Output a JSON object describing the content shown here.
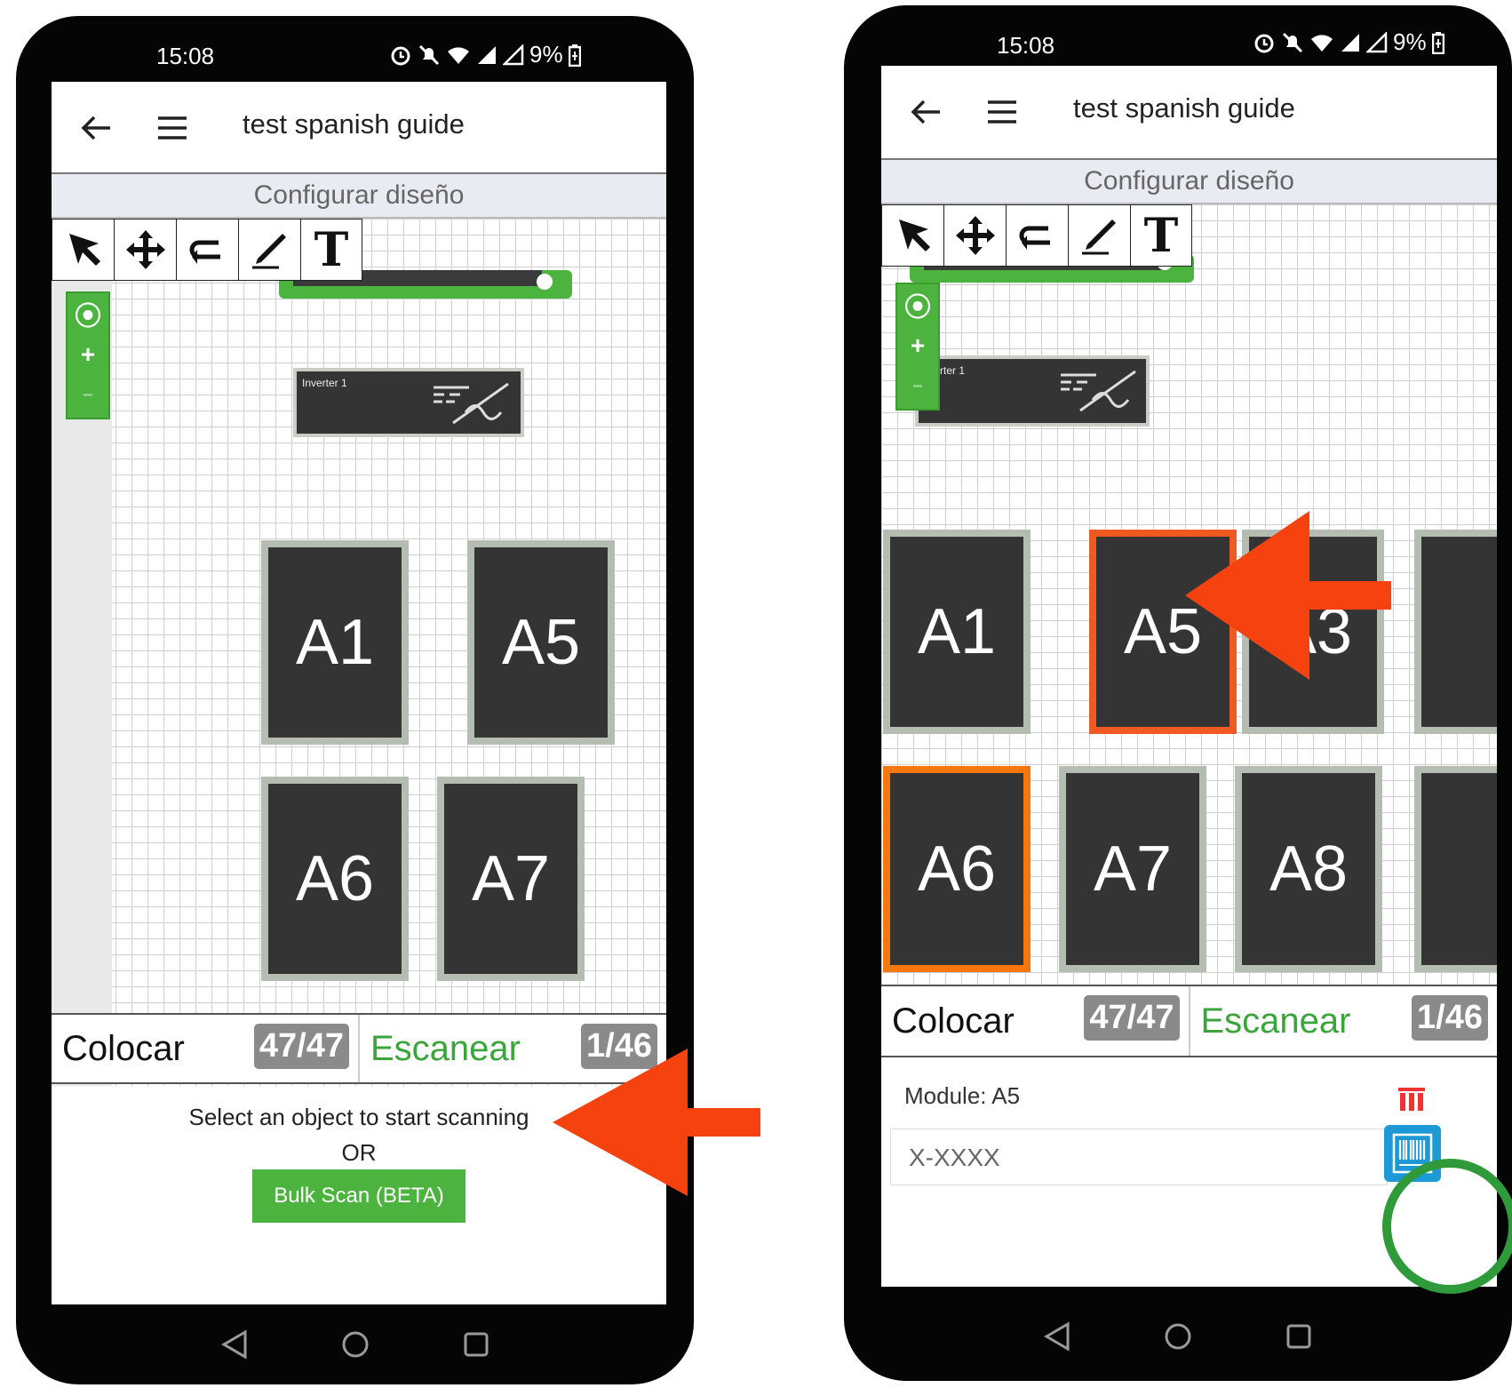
{
  "colors": {
    "accent_green": "#4cb43e",
    "text_green": "#3aa53a",
    "arrow_red": "#f5420f",
    "select_red": "#f05a22",
    "select_orange": "#f7770f",
    "ring_green": "#2f9a3a",
    "barcode_blue": "#1d9ad6"
  },
  "status": {
    "time": "15:08",
    "battery": "9%"
  },
  "app": {
    "title": "test spanish guide",
    "subtitle": "Configurar diseño"
  },
  "toolbar": {
    "tools": [
      "pointer-icon",
      "move-icon",
      "undo-icon",
      "pencil-icon",
      "text-tool-icon"
    ],
    "text_tool_label": "T"
  },
  "zoom": {
    "locate": "⦿",
    "plus": "+",
    "minus": "−"
  },
  "phone1": {
    "inverter_label": "Inverter 1",
    "modules": [
      "A1",
      "A5",
      "A6",
      "A7"
    ],
    "tabs": {
      "place_label": "Colocar",
      "place_count": "47/47",
      "scan_label": "Escanear",
      "scan_count": "1/46"
    },
    "hint": "Select an object to start scanning",
    "or": "OR",
    "bulk_button": "Bulk Scan (BETA)"
  },
  "phone2": {
    "inverter_label": "rter 1",
    "modules": [
      "A1",
      "A5",
      "A3",
      "A6",
      "A7",
      "A8"
    ],
    "tabs": {
      "place_label": "Colocar",
      "place_count": "47/47",
      "scan_label": "Escanear",
      "scan_count": "1/46"
    },
    "module_label": "Module: A5",
    "serial_placeholder": "X-XXXX"
  }
}
